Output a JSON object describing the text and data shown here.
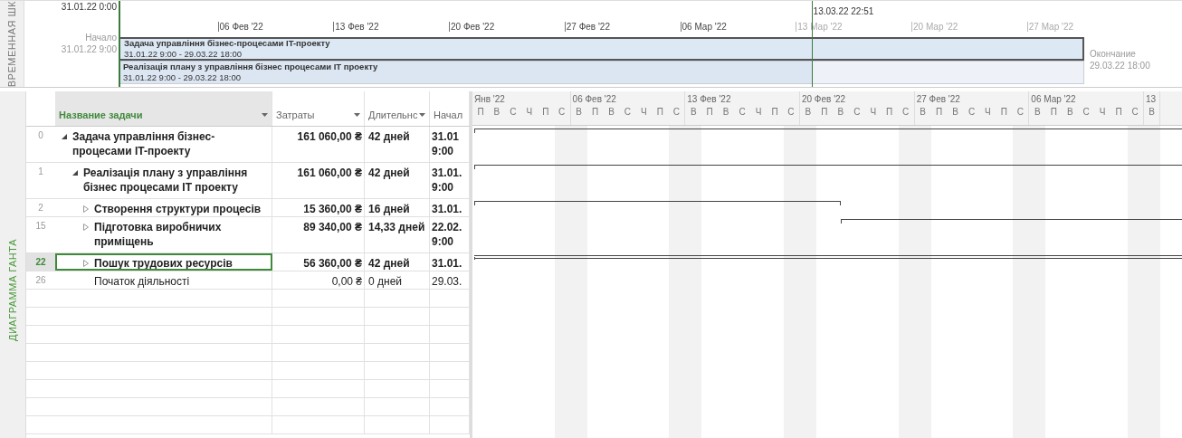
{
  "timeline": {
    "side_label": "ВРЕМЕННАЯ ШК",
    "start_time": "31.01.22 0:00",
    "today_label": "13.03.22 22:51",
    "ticks": [
      {
        "label": "06 Фев '22",
        "past": true
      },
      {
        "label": "13 Фев '22",
        "past": true
      },
      {
        "label": "20 Фев '22",
        "past": true
      },
      {
        "label": "27 Фев '22",
        "past": true
      },
      {
        "label": "06 Мар '22",
        "past": true
      },
      {
        "label": "13 Мар '22",
        "past": false
      },
      {
        "label": "20 Мар '22",
        "past": false
      },
      {
        "label": "27 Мар '22",
        "past": false
      }
    ],
    "start": {
      "label": "Начало",
      "date": "31.01.22 9:00"
    },
    "finish": {
      "label": "Окончание",
      "date": "29.03.22 18:00"
    },
    "bars": [
      {
        "title": "Задача управління бізнес-процесами IT-проекту",
        "dates": "31.01.22 9:00 - 29.03.22 18:00",
        "selected": true
      },
      {
        "title": "Реалізація плану з управління бізнес процесами IT проекту",
        "dates": "31.01.22 9:00 - 29.03.22 18:00",
        "selected": false
      }
    ]
  },
  "gantt": {
    "side_label": "ДИАГРАММА ГАНТА",
    "columns": [
      {
        "label": "Название задачи",
        "filter": true,
        "selected": true
      },
      {
        "label": "Затраты",
        "filter": true,
        "selected": false
      },
      {
        "label": "Длительнс",
        "filter": true,
        "selected": false
      },
      {
        "label": "Начал",
        "filter": false,
        "selected": false
      }
    ],
    "weeks": [
      {
        "label": "Янв '22",
        "days": [
          "П",
          "В",
          "С",
          "Ч",
          "П",
          "С"
        ]
      },
      {
        "label": "06 Фев '22",
        "days": [
          "В",
          "П",
          "В",
          "С",
          "Ч",
          "П",
          "С"
        ]
      },
      {
        "label": "13 Фев '22",
        "days": [
          "В",
          "П",
          "В",
          "С",
          "Ч",
          "П",
          "С"
        ]
      },
      {
        "label": "20 Фев '22",
        "days": [
          "В",
          "П",
          "В",
          "С",
          "Ч",
          "П",
          "С"
        ]
      },
      {
        "label": "27 Фев '22",
        "days": [
          "В",
          "П",
          "В",
          "С",
          "Ч",
          "П",
          "С"
        ]
      },
      {
        "label": "06 Мар '22",
        "days": [
          "В",
          "П",
          "В",
          "С",
          "Ч",
          "П",
          "С"
        ]
      },
      {
        "label": "13",
        "days": [
          "В"
        ]
      }
    ],
    "rows": [
      {
        "id": "0",
        "name": "Задача управління бізнес-процесами IT-проекту",
        "cost": "161 060,00 ₴",
        "duration": "42 дней",
        "start": [
          "31.01",
          "9:00"
        ],
        "kind": "summary",
        "expanded": true,
        "selected": false,
        "children": [
          {
            "id": "1",
            "name": "Реалізація плану з управління бізнес процесами IT проекту",
            "cost": "161 060,00 ₴",
            "duration": "42 дней",
            "start": [
              "31.01.",
              "9:00"
            ],
            "kind": "summary",
            "expanded": true,
            "selected": false,
            "children": [
              {
                "id": "2",
                "name": "Створення структури процесів",
                "cost": "15 360,00 ₴",
                "duration": "16 дней",
                "start": [
                  "31.01."
                ],
                "kind": "summary",
                "expanded": false,
                "selected": false
              },
              {
                "id": "15",
                "name": "Підготовка виробничих приміщень",
                "cost": "89 340,00 ₴",
                "duration": "14,33 дней",
                "start": [
                  "22.02.",
                  "9:00"
                ],
                "kind": "summary",
                "expanded": false,
                "selected": false
              },
              {
                "id": "22",
                "name": "Пошук трудових ресурсів",
                "cost": "56 360,00 ₴",
                "duration": "42 дней",
                "start": [
                  "31.01."
                ],
                "kind": "summary",
                "expanded": false,
                "selected": true
              },
              {
                "id": "26",
                "name": "Початок діяльності",
                "cost": "0,00 ₴",
                "duration": "0 дней",
                "start": [
                  "29.03."
                ],
                "kind": "task",
                "selected": false
              }
            ]
          }
        ]
      }
    ]
  }
}
